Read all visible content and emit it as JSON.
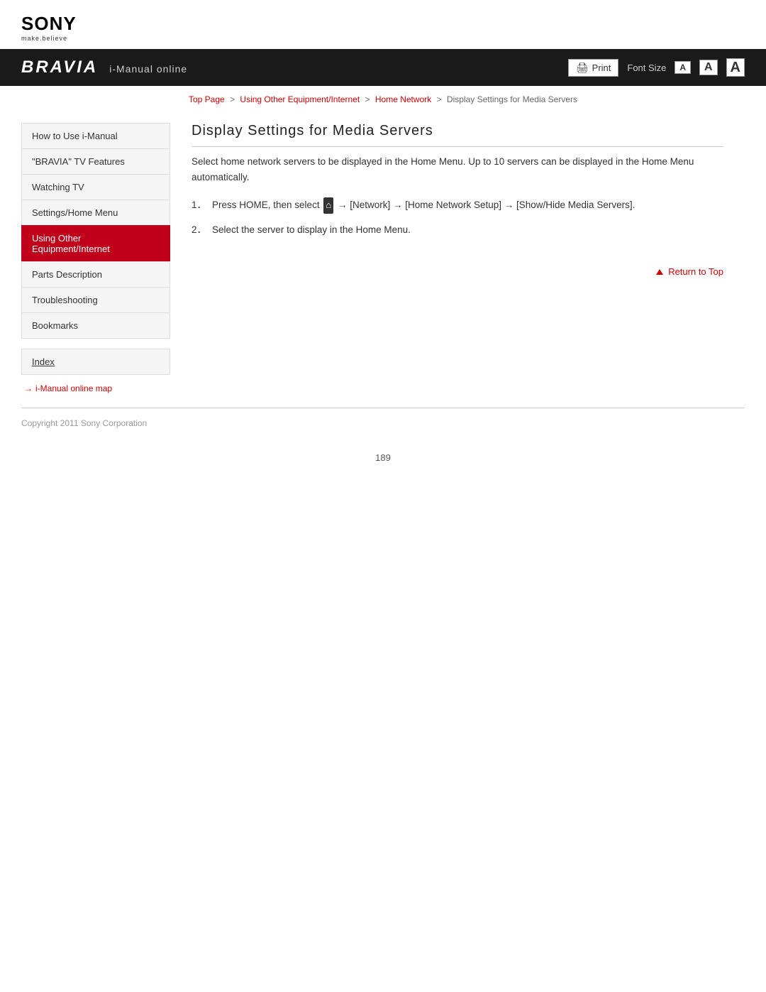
{
  "header": {
    "sony_text": "SONY",
    "tagline": "make.believe",
    "bravia_logo": "BRAVIA",
    "bravia_subtitle": "i-Manual online",
    "print_label": "Print",
    "font_size_label": "Font Size",
    "font_btn_sm": "A",
    "font_btn_md": "A",
    "font_btn_lg": "A"
  },
  "breadcrumb": {
    "top_page": "Top Page",
    "sep1": ">",
    "using_other": "Using Other Equipment/Internet",
    "sep2": ">",
    "home_network": "Home Network",
    "sep3": ">",
    "current": "Display Settings for Media Servers"
  },
  "sidebar": {
    "items": [
      {
        "label": "How to Use i-Manual",
        "active": false
      },
      {
        "label": "\"BRAVIA\" TV Features",
        "active": false
      },
      {
        "label": "Watching TV",
        "active": false
      },
      {
        "label": "Settings/Home Menu",
        "active": false
      },
      {
        "label": "Using Other Equipment/Internet",
        "active": true
      },
      {
        "label": "Parts Description",
        "active": false
      },
      {
        "label": "Troubleshooting",
        "active": false
      },
      {
        "label": "Bookmarks",
        "active": false
      }
    ],
    "index_label": "Index",
    "map_link_label": "i-Manual online map"
  },
  "content": {
    "page_title": "Display Settings for Media Servers",
    "intro": "Select home network servers to be displayed in the Home Menu. Up to 10 servers can be displayed in the Home Menu automatically.",
    "steps": [
      {
        "num": "1．",
        "text": "Press HOME, then select [icon] → [Network] → [Home Network Setup] → [Show/Hide Media Servers]."
      },
      {
        "num": "2．",
        "text": "Select the server to display in the Home Menu."
      }
    ],
    "return_to_top": "Return to Top"
  },
  "footer": {
    "copyright": "Copyright 2011 Sony Corporation",
    "page_number": "189"
  }
}
